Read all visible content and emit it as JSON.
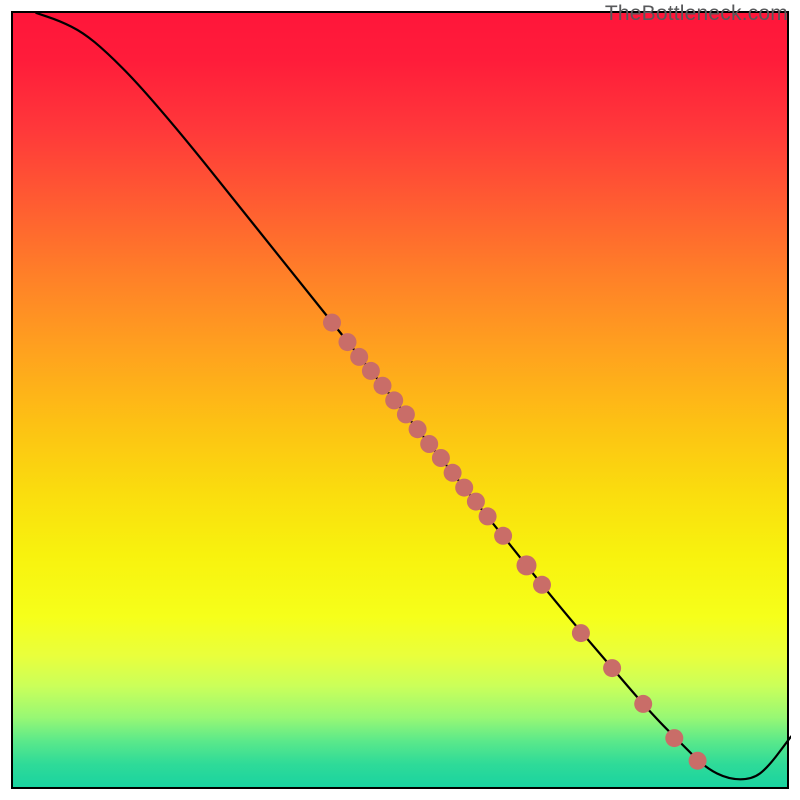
{
  "watermark": "TheBottleneck.com",
  "chart_data": {
    "type": "line",
    "title": "",
    "xlabel": "",
    "ylabel": "",
    "xlim": [
      0,
      100
    ],
    "ylim": [
      0,
      100
    ],
    "grid": false,
    "series": [
      {
        "name": "curve",
        "x": [
          3,
          6,
          9,
          12,
          16,
          22,
          30,
          38,
          46,
          54,
          62,
          70,
          76,
          82,
          86,
          89,
          92,
          95,
          97,
          100
        ],
        "y": [
          100,
          99,
          97.5,
          95,
          91,
          84,
          74,
          64,
          54,
          44,
          34,
          24,
          17,
          10,
          6,
          3,
          1.5,
          1.5,
          3,
          7
        ]
      }
    ],
    "points": {
      "name": "markers",
      "x": [
        41,
        43,
        44.5,
        46,
        47.5,
        49,
        50.5,
        52,
        53.5,
        55,
        56.5,
        58,
        59.5,
        61,
        63,
        66,
        68,
        73,
        77,
        81,
        85,
        88
      ],
      "y": [
        60.2,
        57.7,
        55.8,
        54.0,
        52.1,
        50.2,
        48.4,
        46.5,
        44.6,
        42.8,
        40.9,
        39.0,
        37.2,
        35.3,
        32.8,
        29.0,
        26.5,
        20.3,
        15.8,
        11.2,
        6.8,
        3.9
      ],
      "r": [
        9,
        9,
        9,
        9,
        9,
        9,
        9,
        9,
        9,
        9,
        9,
        9,
        9,
        9,
        9,
        10,
        9,
        9,
        9,
        9,
        9,
        9
      ]
    }
  }
}
